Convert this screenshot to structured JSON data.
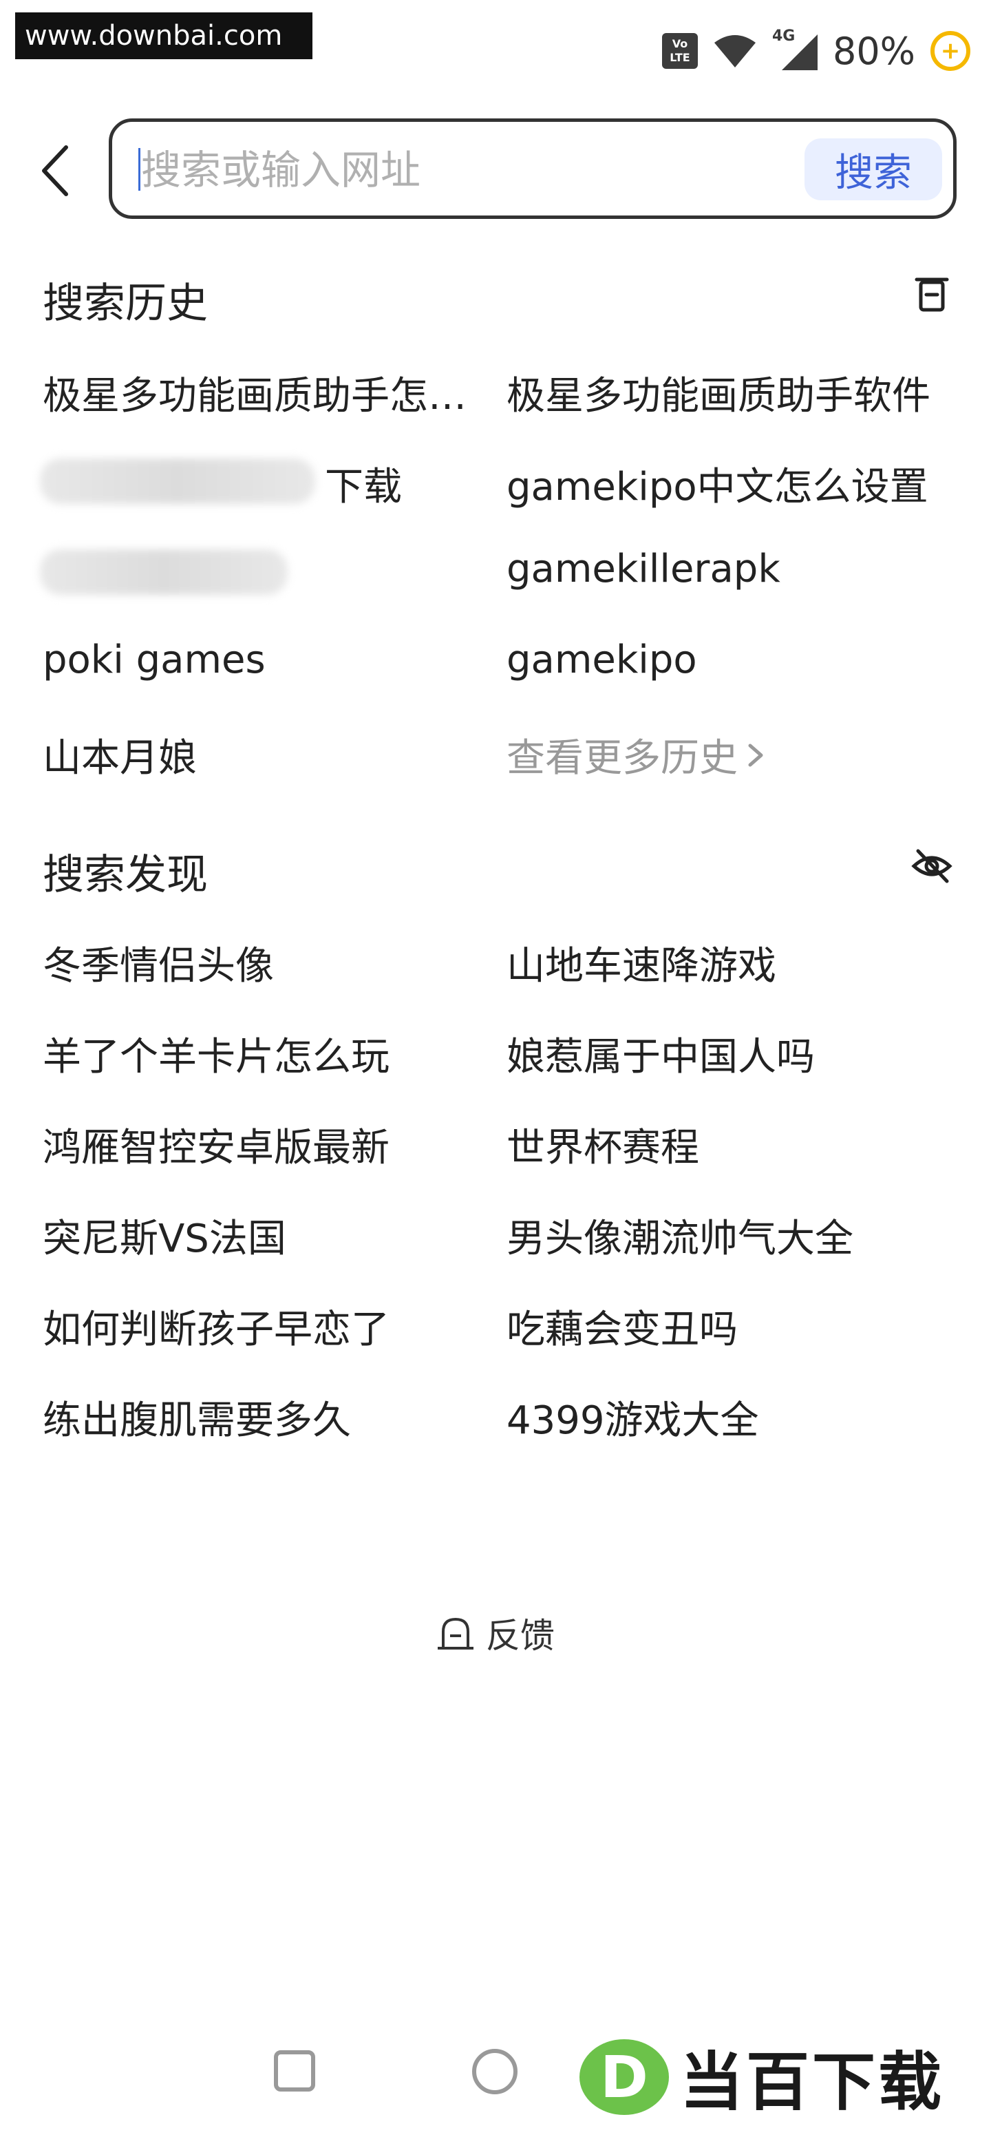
{
  "watermark": {
    "site": "www.downbai.com",
    "brand": "当百下载",
    "logo_letter": "D"
  },
  "status_bar": {
    "network": "4G",
    "volte_label": "Vo LTE",
    "battery": "80%",
    "battery_badge": "+"
  },
  "search": {
    "placeholder": "搜索或输入网址",
    "button_label": "搜索"
  },
  "history": {
    "title": "搜索历史",
    "left": [
      "极星多功能画质助手怎么用",
      "下载",
      "",
      "poki games",
      "山本月娘"
    ],
    "right": [
      "极星多功能画质助手软件",
      "gamekipo中文怎么设置",
      "gamekillerapk",
      "gamekipo"
    ],
    "more_label": "查看更多历史"
  },
  "discover": {
    "title": "搜索发现",
    "left": [
      "冬季情侣头像",
      "羊了个羊卡片怎么玩",
      "鸿雁智控安卓版最新",
      "突尼斯VS法国",
      "如何判断孩子早恋了",
      "练出腹肌需要多久"
    ],
    "right": [
      "山地车速降游戏",
      "娘惹属于中国人吗",
      "世界杯赛程",
      "男头像潮流帅气大全",
      "吃藕会变丑吗",
      "4399游戏大全"
    ]
  },
  "feedback": {
    "label": "反馈"
  }
}
